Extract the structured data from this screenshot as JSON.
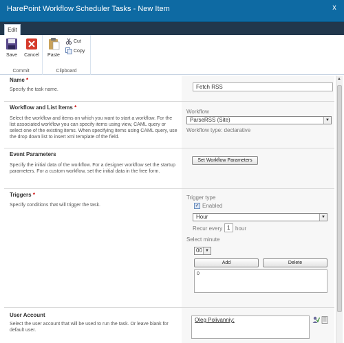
{
  "title": "HarePoint Workflow Scheduler Tasks - New Item",
  "close_glyph": "x",
  "tabs": [
    {
      "label": "Edit"
    }
  ],
  "ribbon": {
    "commit": {
      "label": "Commit",
      "save": "Save",
      "cancel": "Cancel"
    },
    "clipboard": {
      "label": "Clipboard",
      "paste": "Paste",
      "cut": "Cut",
      "copy": "Copy"
    }
  },
  "name_section": {
    "title": "Name",
    "required": "*",
    "desc": "Specify the task name.",
    "value": "Fetch RSS"
  },
  "workflow_section": {
    "title": "Workflow and List Items",
    "required": "*",
    "desc": "Select the workflow and items on which you want to start a workflow. For the list associated workflow you can specify items using view, CAML query or select one of the existing items. When specifying items using CAML query, use the drop down list to insert xml template of the field.",
    "workflow_label": "Workflow",
    "workflow_value": "ParseRSS (Site)",
    "workflow_type": "Workflow type: declarative"
  },
  "event_section": {
    "title": "Event Parameters",
    "desc": "Specify the initial data of the workflow. For a designer workflow set the startup parameters. For a custom workflow, set the initial data in the free form.",
    "button": "Set Workflow Parameters"
  },
  "triggers_section": {
    "title": "Triggers",
    "required": "*",
    "desc": "Specify conditions that will trigger the task.",
    "trigger_type_label": "Trigger type",
    "enabled_label": "Enabled",
    "enabled_check": "✓",
    "period_value": "Hour",
    "recur_prefix": "Recur every",
    "recur_value": "1",
    "recur_suffix": "hour",
    "select_minute_label": "Select minute",
    "minute_value": "00",
    "add_button": "Add",
    "delete_button": "Delete",
    "minute_list": [
      "0"
    ]
  },
  "user_section": {
    "title": "User Account",
    "desc": "Select the user account that will be used to run the task. Or leave blank for default user.",
    "value": "Oleg Polivanniy;"
  },
  "colors": {
    "titlebar": "#0e6aa3",
    "tabstrip": "#21374c",
    "required": "#cc0000"
  }
}
